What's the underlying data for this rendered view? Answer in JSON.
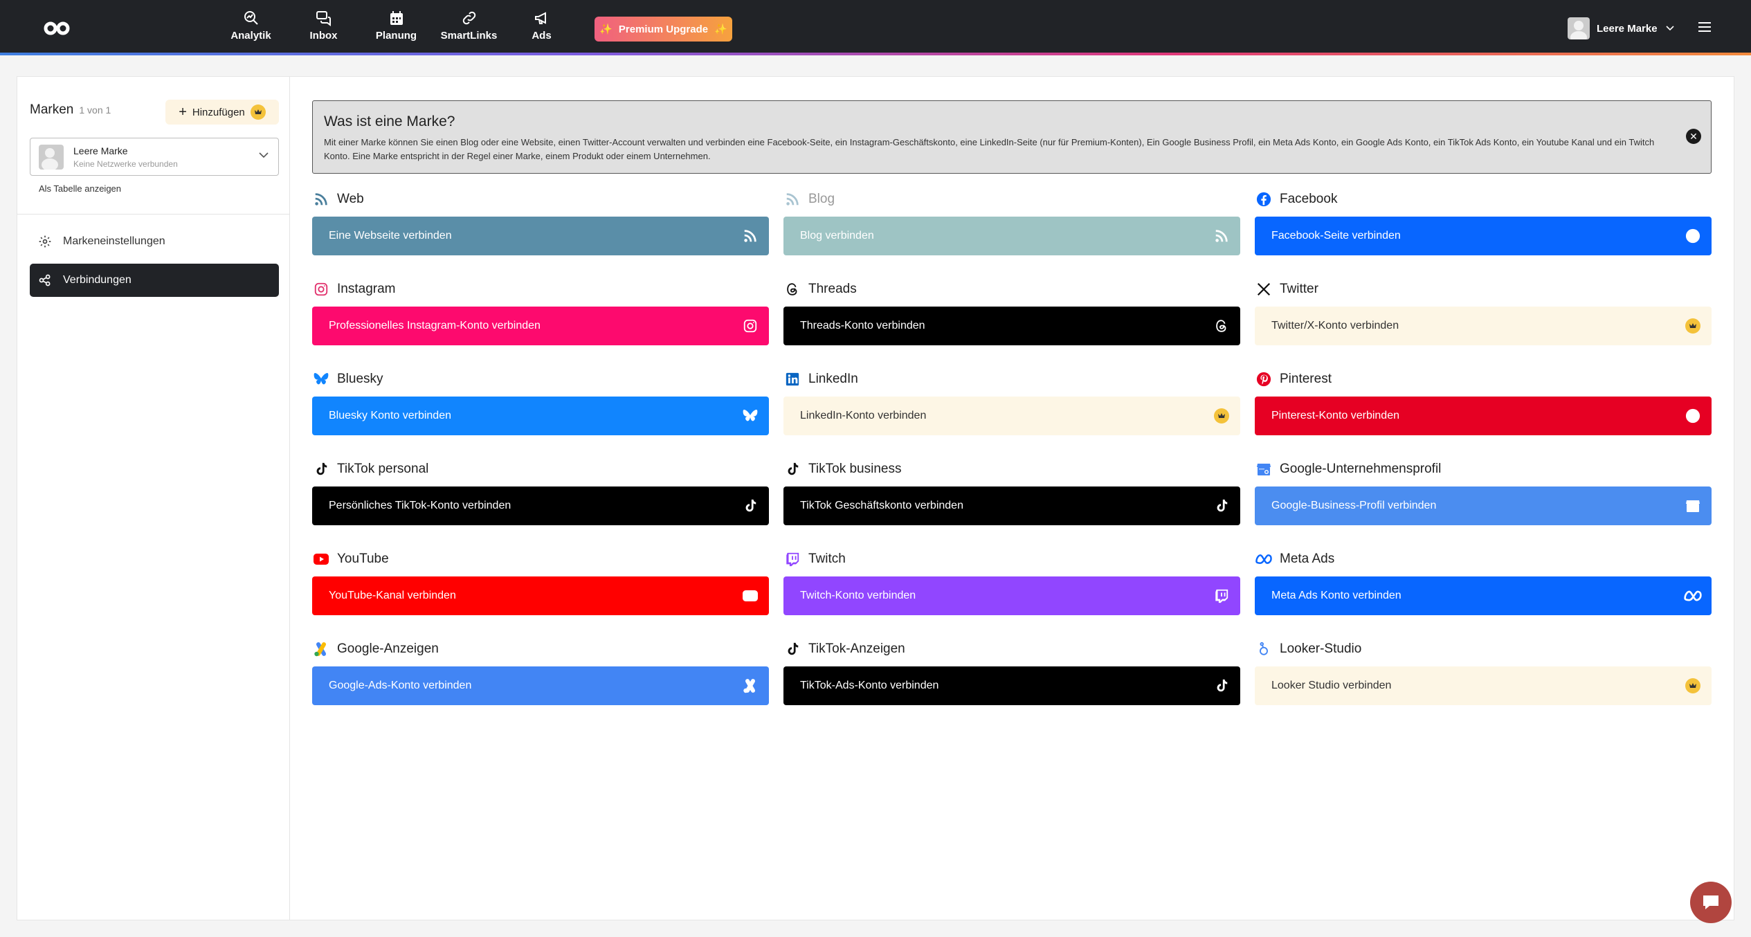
{
  "topbar": {
    "nav": [
      {
        "label": "Analytik",
        "icon": "magnifier-chart-icon"
      },
      {
        "label": "Inbox",
        "icon": "chat-bubbles-icon"
      },
      {
        "label": "Planung",
        "icon": "calendar-icon"
      },
      {
        "label": "SmartLinks",
        "icon": "link-icon"
      },
      {
        "label": "Ads",
        "icon": "megaphone-icon"
      }
    ],
    "premium_label": "Premium Upgrade",
    "user_name": "Leere Marke"
  },
  "sidebar": {
    "title": "Marken",
    "count": "1 von 1",
    "add_label": "Hinzufügen",
    "brand_name": "Leere Marke",
    "brand_sub": "Keine Netzwerke verbunden",
    "table_link": "Als Tabelle anzeigen",
    "items": [
      {
        "label": "Markeneinstellungen",
        "icon": "gear-icon"
      },
      {
        "label": "Verbindungen",
        "icon": "share-nodes-icon"
      }
    ]
  },
  "info": {
    "title": "Was ist eine Marke?",
    "text": "Mit einer Marke können Sie einen Blog oder eine Website, einen Twitter-Account verwalten und verbinden eine Facebook-Seite, ein Instagram-Geschäftskonto, eine LinkedIn-Seite (nur für Premium-Konten), Ein Google Business Profil, ein Meta Ads Konto, ein Google Ads Konto, ein TikTok Ads Konto, ein Youtube Kanal und ein Twitch Konto. Eine Marke entspricht in der Regel einer Marke, einem Produkt oder einem Unternehmen."
  },
  "connections": [
    {
      "title": "Web",
      "button": "Eine Webseite verbinden",
      "icon": "rss-icon",
      "color": "#5a8ea8",
      "icon_color": "#4a7f9c"
    },
    {
      "title": "Blog",
      "button": "Blog verbinden",
      "icon": "rss-icon",
      "color": "#9ec4c4",
      "icon_color": "#a9c4d1"
    },
    {
      "title": "Facebook",
      "button": "Facebook-Seite verbinden",
      "icon": "facebook-icon",
      "color": "#0866ff",
      "icon_color": "#0866ff"
    },
    {
      "title": "Instagram",
      "button": "Professionelles Instagram-Konto verbinden",
      "icon": "instagram-icon",
      "color": "#fd0a6e",
      "icon_color": "#e1306c"
    },
    {
      "title": "Threads",
      "button": "Threads-Konto verbinden",
      "icon": "threads-icon",
      "color": "#000000",
      "icon_color": "#111111"
    },
    {
      "title": "Twitter",
      "button": "Twitter/X-Konto verbinden",
      "icon": "x-icon",
      "color": "#fdf6e5",
      "icon_color": "#111111",
      "premium": true
    },
    {
      "title": "Bluesky",
      "button": "Bluesky Konto verbinden",
      "icon": "butterfly-icon",
      "color": "#1185fe",
      "icon_color": "#1185fe"
    },
    {
      "title": "LinkedIn",
      "button": "LinkedIn-Konto verbinden",
      "icon": "linkedin-icon",
      "color": "#fdf6e5",
      "icon_color": "#0a66c2",
      "premium": true
    },
    {
      "title": "Pinterest",
      "button": "Pinterest-Konto verbinden",
      "icon": "pinterest-icon",
      "color": "#e60023",
      "icon_color": "#e60023"
    },
    {
      "title": "TikTok personal",
      "button": "Persönliches TikTok-Konto verbinden",
      "icon": "tiktok-icon",
      "color": "#000000",
      "icon_color": "#111111"
    },
    {
      "title": "TikTok business",
      "button": "TikTok Geschäftskonto verbinden",
      "icon": "tiktok-icon",
      "color": "#000000",
      "icon_color": "#111111"
    },
    {
      "title": "Google-Unternehmensprofil",
      "button": "Google-Business-Profil verbinden",
      "icon": "storefront-icon",
      "color": "#4b8df0",
      "icon_color": "#4285f4"
    },
    {
      "title": "YouTube",
      "button": "YouTube-Kanal verbinden",
      "icon": "youtube-icon",
      "color": "#ff0000",
      "icon_color": "#ff0000"
    },
    {
      "title": "Twitch",
      "button": "Twitch-Konto verbinden",
      "icon": "twitch-icon",
      "color": "#9146ff",
      "icon_color": "#9146ff"
    },
    {
      "title": "Meta Ads",
      "button": "Meta Ads Konto verbinden",
      "icon": "meta-icon",
      "color": "#0866ff",
      "icon_color": "#0866ff"
    },
    {
      "title": "Google-Anzeigen",
      "button": "Google-Ads-Konto verbinden",
      "icon": "google-ads-icon",
      "color": "#4285f4",
      "icon_color": "#4285f4"
    },
    {
      "title": "TikTok-Anzeigen",
      "button": "TikTok-Ads-Konto verbinden",
      "icon": "tiktok-icon",
      "color": "#000000",
      "icon_color": "#111111"
    },
    {
      "title": "Looker-Studio",
      "button": "Looker Studio verbinden",
      "icon": "looker-icon",
      "color": "#fdf6e5",
      "icon_color": "#4285f4",
      "premium": true
    }
  ]
}
